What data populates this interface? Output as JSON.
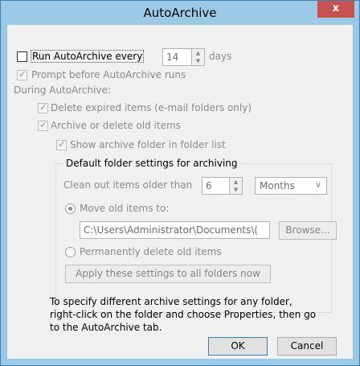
{
  "window": {
    "title": "AutoArchive",
    "close_glyph": "x"
  },
  "run_every": {
    "label": "Run AutoArchive every",
    "value": "14",
    "unit": "days"
  },
  "prompt": {
    "label": "Prompt before AutoArchive runs"
  },
  "during": {
    "label": "During AutoArchive:"
  },
  "delete_expired": {
    "label": "Delete expired items (e-mail folders only)"
  },
  "archive_old": {
    "label": "Archive or delete old items"
  },
  "show_folder": {
    "label": "Show archive folder in folder list"
  },
  "group": {
    "title": "Default folder settings for archiving"
  },
  "clean_out": {
    "label": "Clean out items older than",
    "value": "6",
    "unit_selected": "Months"
  },
  "move_old": {
    "label": "Move old items to:",
    "path": "C:\\Users\\Administrator\\Documents\\(",
    "browse_label": "Browse..."
  },
  "perm_delete": {
    "label": "Permanently delete old items"
  },
  "apply_all": {
    "label": "Apply these settings to all folders now"
  },
  "info": {
    "line1": "To specify different archive settings for any folder,",
    "line2": "right-click on the folder and choose Properties, then go",
    "line3": "to the AutoArchive tab."
  },
  "buttons": {
    "ok": "OK",
    "cancel": "Cancel"
  }
}
